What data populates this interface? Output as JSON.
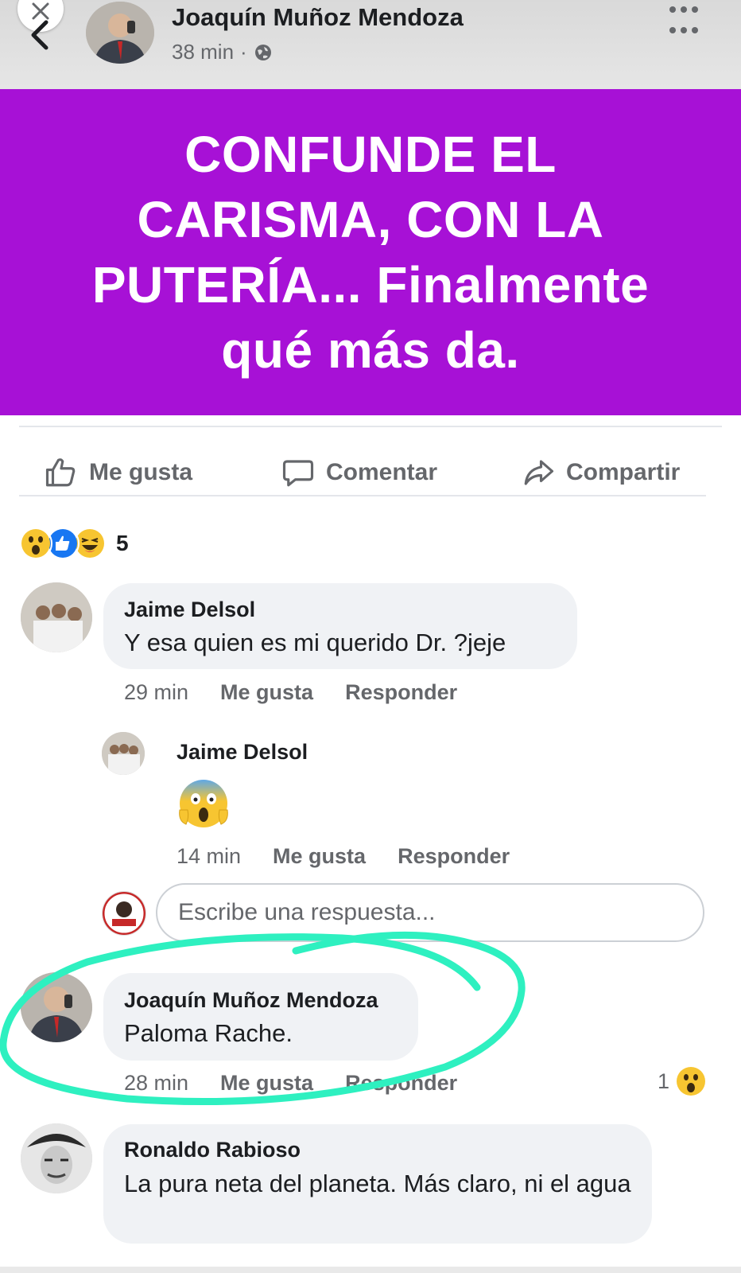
{
  "post": {
    "author": "Joaquín Muñoz Mendoza",
    "time": "38 min",
    "separator": "·",
    "privacy_icon": "globe-icon",
    "banner_text": "CONFUNDE EL CARISMA, CON LA PUTERÍA... Finalmente qué más da.",
    "banner_color": "#a711d6"
  },
  "actions": {
    "like": "Me gusta",
    "comment": "Comentar",
    "share": "Compartir"
  },
  "reactions": {
    "icons": [
      "wow-icon",
      "like-icon",
      "haha-icon"
    ],
    "count": "5"
  },
  "comments": [
    {
      "author": "Jaime Delsol",
      "text": "Y esa quien es mi querido Dr. ?jeje",
      "time": "29 min",
      "like": "Me gusta",
      "reply": "Responder"
    },
    {
      "author": "Jaime Delsol",
      "emoji": "😱",
      "time": "14 min",
      "like": "Me gusta",
      "reply": "Responder"
    },
    {
      "author": "Joaquín Muñoz Mendoza",
      "text": "Paloma Rache.",
      "time": "28 min",
      "like": "Me gusta",
      "reply": "Responder",
      "reaction_count": "1",
      "reaction_icon": "wow-icon"
    },
    {
      "author": "Ronaldo Rabioso",
      "text": "La pura neta del planeta. Más claro, ni el agua"
    }
  ],
  "reply_box": {
    "placeholder": "Escribe una respuesta..."
  },
  "colors": {
    "highlight": "#2ef0c0",
    "bubble": "#f0f2f5",
    "secondary_text": "#65676b"
  }
}
